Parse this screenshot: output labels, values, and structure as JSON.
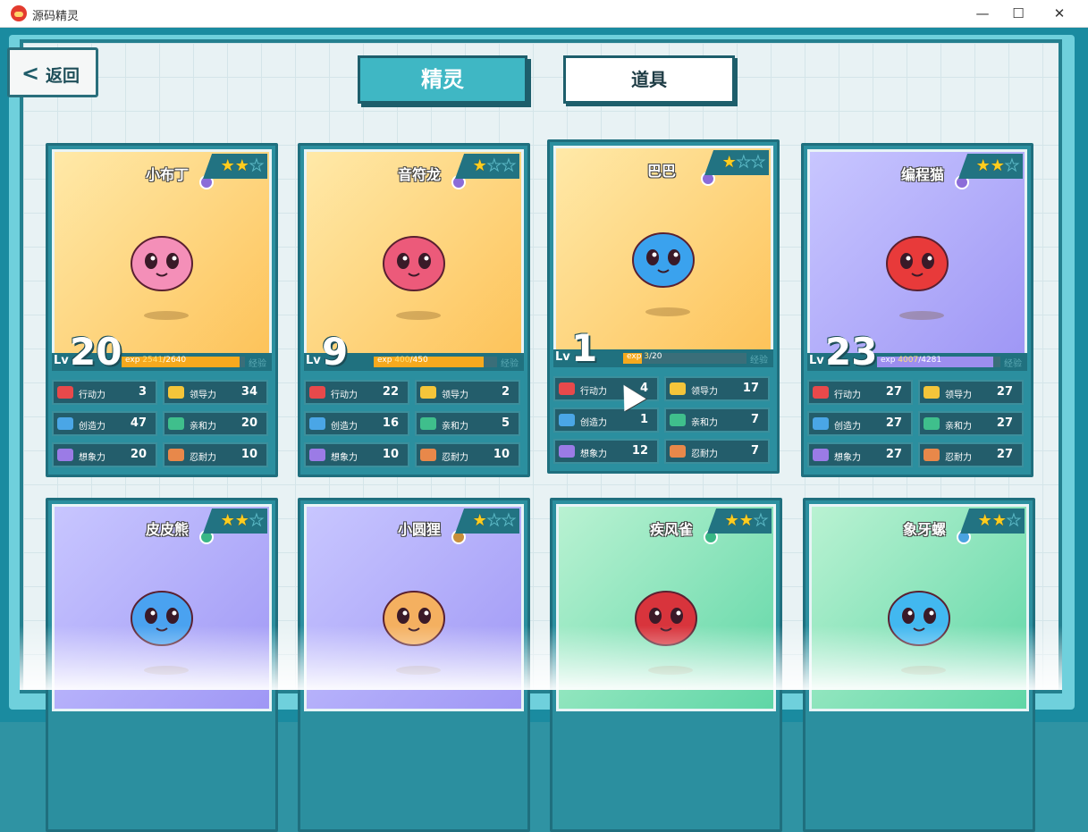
{
  "window": {
    "title": "源码精灵",
    "minimize": "—",
    "maximize": "☐",
    "close": "✕"
  },
  "back_label": "返回",
  "tabs": {
    "active": "精灵",
    "inactive": "道具"
  },
  "stat_labels": [
    "行动力",
    "领导力",
    "创造力",
    "亲和力",
    "想象力",
    "忍耐力"
  ],
  "lv_label": "Lv",
  "exp_label": "exp",
  "jy_label": "经验",
  "cards": [
    {
      "name": "小布丁",
      "stars": 2,
      "level": "20",
      "exp_cur": "2541",
      "exp_max": "/2640",
      "exp_fraction": 0.96,
      "theme": "orange",
      "stats": [
        "3",
        "34",
        "47",
        "20",
        "20",
        "10"
      ]
    },
    {
      "name": "音符龙",
      "stars": 1,
      "level": "9",
      "exp_cur": "400",
      "exp_max": "/450",
      "exp_fraction": 0.89,
      "theme": "orange",
      "stats": [
        "22",
        "2",
        "16",
        "5",
        "10",
        "10"
      ]
    },
    {
      "name": "巴巴",
      "stars": 1,
      "level": "1",
      "exp_cur": "3",
      "exp_max": "/20",
      "exp_fraction": 0.15,
      "theme": "orange",
      "stats": [
        "4",
        "17",
        "1",
        "7",
        "12",
        "7"
      ]
    },
    {
      "name": "编程猫",
      "stars": 2,
      "level": "23",
      "exp_cur": "4007",
      "exp_max": "/4281",
      "exp_fraction": 0.94,
      "theme": "purple",
      "stats": [
        "27",
        "27",
        "27",
        "27",
        "27",
        "27"
      ]
    },
    {
      "name": "皮皮熊",
      "stars": 2,
      "theme": "purple"
    },
    {
      "name": "小圆狸",
      "stars": 1,
      "theme": "purple"
    },
    {
      "name": "疾风雀",
      "stars": 2,
      "theme": "green"
    },
    {
      "name": "象牙螺",
      "stars": 2,
      "theme": "green"
    }
  ],
  "colors": {
    "accent": "#3fb7c4",
    "frame": "#1d5e6b",
    "exp": "#f6a91e"
  }
}
